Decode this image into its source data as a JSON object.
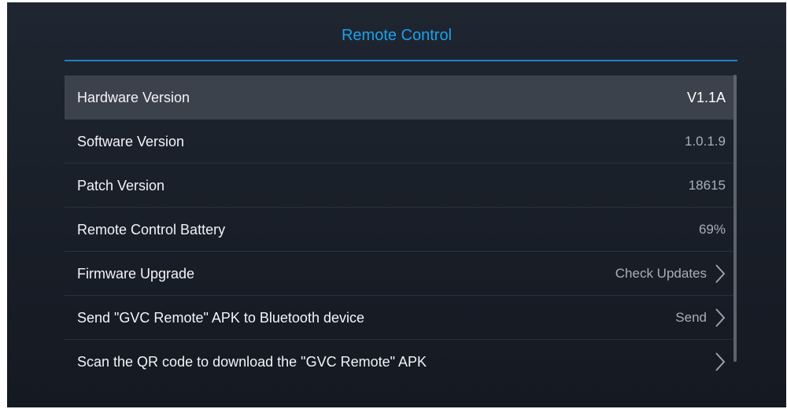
{
  "header": {
    "title": "Remote Control"
  },
  "colors": {
    "accent": "#1ba0ee",
    "background": "#1a2029",
    "selected_row": "#3c424c"
  },
  "list": {
    "items": [
      {
        "label": "Hardware Version",
        "value": "V1.1A",
        "selected": true,
        "chevron": false
      },
      {
        "label": "Software Version",
        "value": "1.0.1.9",
        "selected": false,
        "chevron": false
      },
      {
        "label": "Patch Version",
        "value": "18615",
        "selected": false,
        "chevron": false
      },
      {
        "label": "Remote Control Battery",
        "value": "69%",
        "selected": false,
        "chevron": false
      },
      {
        "label": "Firmware Upgrade",
        "value": "Check Updates",
        "selected": false,
        "chevron": true,
        "icon": "chevron-right-icon"
      },
      {
        "label": "Send \"GVC Remote\" APK to Bluetooth device",
        "value": "Send",
        "selected": false,
        "chevron": true,
        "icon": "chevron-right-icon"
      },
      {
        "label": "Scan the QR code to download the \"GVC Remote\" APK",
        "value": "",
        "selected": false,
        "chevron": true,
        "icon": "chevron-right-icon"
      }
    ]
  }
}
